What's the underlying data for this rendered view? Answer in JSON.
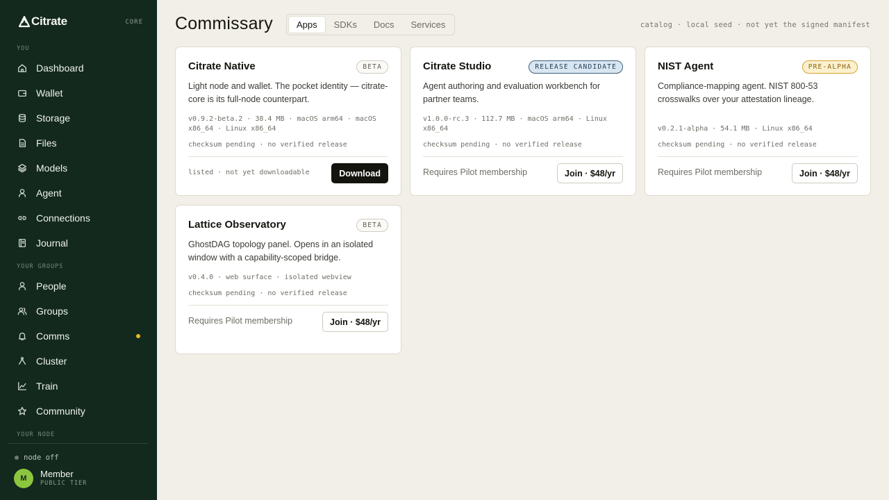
{
  "brand": {
    "name": "Citrate",
    "tag": "CORE"
  },
  "sidebar": {
    "sections": {
      "you": "YOU",
      "groups": "YOUR GROUPS",
      "node": "YOUR NODE"
    },
    "you_items": [
      {
        "label": "Dashboard",
        "icon": "home-icon"
      },
      {
        "label": "Wallet",
        "icon": "wallet-icon"
      },
      {
        "label": "Storage",
        "icon": "database-icon"
      },
      {
        "label": "Files",
        "icon": "file-icon"
      },
      {
        "label": "Models",
        "icon": "layers-icon"
      },
      {
        "label": "Agent",
        "icon": "agent-icon"
      },
      {
        "label": "Connections",
        "icon": "link-icon"
      },
      {
        "label": "Journal",
        "icon": "journal-icon"
      }
    ],
    "group_items": [
      {
        "label": "People",
        "icon": "person-icon"
      },
      {
        "label": "Groups",
        "icon": "users-icon"
      },
      {
        "label": "Comms",
        "icon": "bell-icon",
        "notification": true
      },
      {
        "label": "Cluster",
        "icon": "cluster-icon"
      },
      {
        "label": "Train",
        "icon": "chart-line-icon"
      },
      {
        "label": "Community",
        "icon": "star-icon"
      }
    ],
    "node_status": "node off",
    "user": {
      "initial": "M",
      "name": "Member",
      "tier": "PUBLIC TIER"
    }
  },
  "header": {
    "title": "Commissary",
    "tabs": [
      "Apps",
      "SDKs",
      "Docs",
      "Services"
    ],
    "active_tab": "Apps",
    "catalog_note": "catalog · local seed · not yet the signed manifest"
  },
  "cards": [
    {
      "title": "Citrate Native",
      "badge": "BETA",
      "desc": "Light node and wallet. The pocket identity — citrate-core is its full-node counterpart.",
      "meta": "v0.9.2-beta.2 · 38.4 MB · macOS arm64 · macOS x86_64 · Linux x86_64",
      "checksum": "checksum pending · no verified release",
      "footer": "listed · not yet downloadable",
      "action": "Download"
    },
    {
      "title": "Citrate Studio",
      "badge": "RELEASE CANDIDATE",
      "desc": "Agent authoring and evaluation workbench for partner teams.",
      "meta": "v1.0.0-rc.3 · 112.7 MB · macOS arm64 · Linux x86_64",
      "checksum": "checksum pending · no verified release",
      "footer": "Requires Pilot membership",
      "action": "Join · $48/yr"
    },
    {
      "title": "NIST Agent",
      "badge": "PRE-ALPHA",
      "desc": "Compliance-mapping agent. NIST 800-53 crosswalks over your attestation lineage.",
      "meta": "v0.2.1-alpha · 54.1 MB · Linux x86_64",
      "checksum": "checksum pending · no verified release",
      "footer": "Requires Pilot membership",
      "action": "Join · $48/yr"
    },
    {
      "title": "Lattice Observatory",
      "badge": "BETA",
      "desc": "GhostDAG topology panel. Opens in an isolated window with a capability-scoped bridge.",
      "meta": "v0.4.0 · web surface · isolated webview",
      "checksum": "checksum pending · no verified release",
      "footer": "Requires Pilot membership",
      "action": "Join · $48/yr"
    }
  ],
  "colors": {
    "sidebar_bg": "#13291d",
    "page_bg": "#f2efe8",
    "accent_dot": "#e8b923",
    "avatar": "#8cc63f",
    "badge_rc": "#d8e6f1",
    "badge_alpha": "#fbf1cf"
  }
}
